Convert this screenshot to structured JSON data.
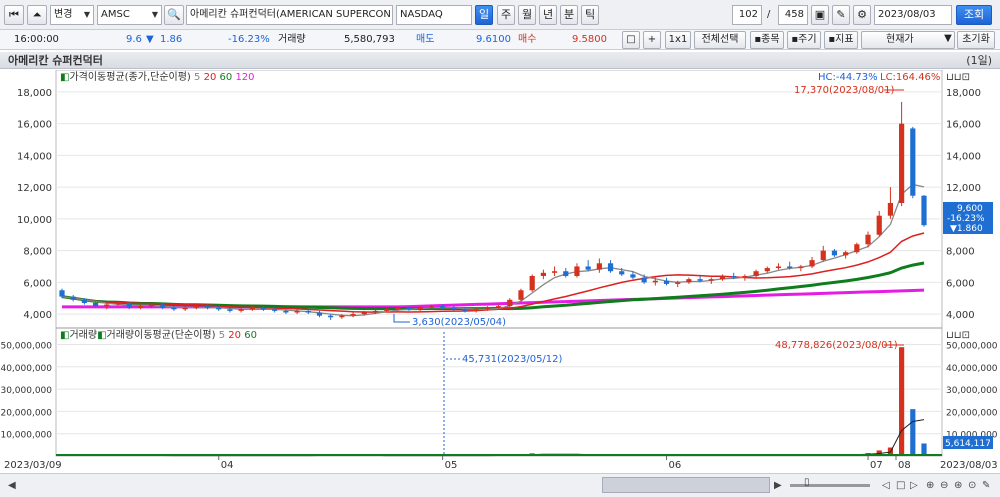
{
  "toolbar": {
    "nav_first": "⏮",
    "nav_top": "⏶",
    "change_label": "변경",
    "code": "AMSC",
    "name": "아메리칸 슈퍼컨덕터(AMERICAN SUPERCON",
    "exchange": "NASDAQ",
    "periods": [
      "일",
      "주",
      "월",
      "년",
      "분",
      "틱"
    ],
    "active_period": "일",
    "count": "102",
    "total": "458",
    "date": "2023/08/03",
    "search_label": "조회"
  },
  "quote": {
    "time": "16:00:00",
    "price": "9.6",
    "change_arrow": "▼",
    "change": "1.86",
    "change_pct": "-16.23%",
    "volume_label": "거래량",
    "volume": "5,580,793",
    "ask_label": "매도",
    "ask": "9.6100",
    "bid_label": "매수",
    "bid": "9.5800",
    "buttons": [
      "+",
      "1x1",
      "전체선택",
      "▪종목",
      "▪주기",
      "▪지표"
    ],
    "price_type": "현재가",
    "reset_label": "초기화"
  },
  "title": {
    "name": "아메리칸 슈퍼컨덕터",
    "period": "(1일)"
  },
  "colors": {
    "up": "#d4321e",
    "down": "#1f6fd2",
    "ma5": "#888888",
    "ma20": "#dd1f1f",
    "ma60": "#0f7d1e",
    "ma120": "#e61ce6",
    "accent": "#1e63d6"
  },
  "chart_data": [
    {
      "type": "candlestick",
      "legend": {
        "label": "가격이동평균(종가,단순이평)",
        "periods": [
          "5",
          "20",
          "60",
          "120"
        ]
      },
      "hc": "HC:-44.73%",
      "lc": "LC:164.46%",
      "high_annotation": "17,370(2023/08/01)",
      "low_annotation": "3,630(2023/05/04)",
      "last_label": [
        "9,600",
        "-16.23%",
        "▼1.860"
      ],
      "yticks": [
        "4,000",
        "6,000",
        "8,000",
        "10,000",
        "12,000",
        "14,000",
        "16,000",
        "18,000"
      ],
      "ylim": [
        3500,
        18500
      ],
      "ohlc": [
        [
          5.5,
          5.6,
          5.0,
          5.1
        ],
        [
          5.1,
          5.2,
          4.8,
          4.9
        ],
        [
          4.9,
          5.0,
          4.6,
          4.7
        ],
        [
          4.7,
          4.8,
          4.4,
          4.5
        ],
        [
          4.5,
          4.7,
          4.3,
          4.6
        ],
        [
          4.6,
          4.8,
          4.5,
          4.7
        ],
        [
          4.7,
          4.8,
          4.3,
          4.4
        ],
        [
          4.4,
          4.6,
          4.3,
          4.5
        ],
        [
          4.5,
          4.7,
          4.4,
          4.6
        ],
        [
          4.6,
          4.7,
          4.3,
          4.4
        ],
        [
          4.4,
          4.5,
          4.2,
          4.3
        ],
        [
          4.3,
          4.5,
          4.2,
          4.4
        ],
        [
          4.4,
          4.6,
          4.3,
          4.5
        ],
        [
          4.5,
          4.6,
          4.3,
          4.4
        ],
        [
          4.4,
          4.5,
          4.2,
          4.3
        ],
        [
          4.3,
          4.4,
          4.1,
          4.2
        ],
        [
          4.2,
          4.4,
          4.1,
          4.3
        ],
        [
          4.3,
          4.5,
          4.2,
          4.4
        ],
        [
          4.4,
          4.5,
          4.2,
          4.3
        ],
        [
          4.3,
          4.4,
          4.1,
          4.2
        ],
        [
          4.2,
          4.3,
          4.0,
          4.1
        ],
        [
          4.1,
          4.3,
          4.0,
          4.2
        ],
        [
          4.2,
          4.3,
          4.0,
          4.1
        ],
        [
          4.1,
          4.2,
          3.8,
          3.9
        ],
        [
          3.9,
          4.0,
          3.63,
          3.8
        ],
        [
          3.8,
          4.0,
          3.7,
          3.9
        ],
        [
          3.9,
          4.1,
          3.8,
          4.0
        ],
        [
          4.0,
          4.2,
          3.9,
          4.1
        ],
        [
          4.1,
          4.3,
          4.0,
          4.2
        ],
        [
          4.2,
          4.4,
          4.1,
          4.3
        ],
        [
          4.3,
          4.5,
          4.2,
          4.4
        ],
        [
          4.4,
          4.5,
          4.2,
          4.3
        ],
        [
          4.3,
          4.5,
          4.2,
          4.4
        ],
        [
          4.4,
          4.6,
          4.3,
          4.5
        ],
        [
          4.5,
          4.6,
          4.3,
          4.4
        ],
        [
          4.4,
          4.5,
          4.2,
          4.3
        ],
        [
          4.3,
          4.4,
          4.1,
          4.2
        ],
        [
          4.2,
          4.4,
          4.1,
          4.3
        ],
        [
          4.3,
          4.5,
          4.2,
          4.4
        ],
        [
          4.4,
          4.6,
          4.3,
          4.5
        ],
        [
          4.5,
          5.0,
          4.4,
          4.9
        ],
        [
          4.9,
          5.6,
          4.8,
          5.5
        ],
        [
          5.5,
          6.5,
          5.4,
          6.4
        ],
        [
          6.4,
          6.8,
          6.2,
          6.6
        ],
        [
          6.6,
          7.0,
          6.4,
          6.7
        ],
        [
          6.7,
          6.9,
          6.3,
          6.4
        ],
        [
          6.4,
          7.2,
          6.3,
          7.0
        ],
        [
          7.0,
          7.4,
          6.7,
          6.8
        ],
        [
          6.8,
          7.5,
          6.6,
          7.2
        ],
        [
          7.2,
          7.4,
          6.6,
          6.7
        ],
        [
          6.7,
          6.9,
          6.4,
          6.5
        ],
        [
          6.5,
          6.7,
          6.2,
          6.3
        ],
        [
          6.3,
          6.5,
          5.9,
          6.0
        ],
        [
          6.0,
          6.3,
          5.8,
          6.1
        ],
        [
          6.1,
          6.3,
          5.8,
          5.9
        ],
        [
          5.9,
          6.1,
          5.7,
          6.0
        ],
        [
          6.0,
          6.3,
          5.9,
          6.2
        ],
        [
          6.2,
          6.4,
          6.0,
          6.1
        ],
        [
          6.1,
          6.3,
          5.9,
          6.2
        ],
        [
          6.2,
          6.5,
          6.1,
          6.4
        ],
        [
          6.4,
          6.6,
          6.2,
          6.3
        ],
        [
          6.3,
          6.5,
          6.1,
          6.4
        ],
        [
          6.4,
          6.8,
          6.3,
          6.7
        ],
        [
          6.7,
          7.0,
          6.6,
          6.9
        ],
        [
          6.9,
          7.2,
          6.8,
          7.0
        ],
        [
          7.0,
          7.3,
          6.8,
          6.9
        ],
        [
          6.9,
          7.1,
          6.7,
          7.0
        ],
        [
          7.0,
          7.6,
          6.9,
          7.4
        ],
        [
          7.4,
          8.3,
          7.3,
          8.0
        ],
        [
          8.0,
          8.1,
          7.6,
          7.7
        ],
        [
          7.7,
          8.0,
          7.5,
          7.9
        ],
        [
          7.9,
          8.5,
          7.8,
          8.4
        ],
        [
          8.4,
          9.2,
          8.2,
          9.0
        ],
        [
          9.0,
          10.5,
          8.9,
          10.2
        ],
        [
          10.2,
          12.0,
          10.0,
          11.0
        ],
        [
          11.0,
          17.37,
          10.8,
          16.0
        ],
        [
          15.7,
          15.8,
          11.3,
          11.46
        ],
        [
          11.46,
          11.5,
          9.5,
          9.6
        ]
      ]
    },
    {
      "type": "bar",
      "legend": {
        "volume_label": "거래량",
        "ma_label": "거래량이동평균(단순이평)",
        "periods": [
          "5",
          "20",
          "60"
        ]
      },
      "high_annotation": "48,778,826(2023/08/01)",
      "low_annotation": "45,731(2023/05/12)",
      "last_label": "5,614,117",
      "yticks": [
        "10,000,000",
        "20,000,000",
        "30,000,000",
        "40,000,000",
        "50,000,000"
      ],
      "ylim": [
        0,
        52000000
      ],
      "values": [
        0.4,
        0.3,
        0.3,
        0.2,
        0.2,
        0.3,
        0.2,
        0.2,
        0.2,
        0.2,
        0.2,
        0.2,
        0.2,
        0.2,
        0.2,
        0.2,
        0.2,
        0.2,
        0.2,
        0.2,
        0.2,
        0.2,
        0.2,
        0.3,
        0.4,
        0.2,
        0.2,
        0.2,
        0.2,
        0.2,
        0.2,
        0.2,
        0.2,
        0.2,
        0.2,
        0.2,
        0.2,
        0.2,
        0.2,
        0.3,
        0.5,
        0.9,
        1.2,
        0.8,
        0.6,
        0.5,
        0.7,
        0.6,
        0.6,
        0.5,
        0.4,
        0.4,
        0.4,
        0.3,
        0.3,
        0.3,
        0.3,
        0.3,
        0.3,
        0.3,
        0.3,
        0.3,
        0.4,
        0.4,
        0.4,
        0.3,
        0.3,
        0.5,
        0.9,
        0.5,
        0.5,
        0.7,
        1.3,
        2.5,
        3.8,
        48.78,
        21.0,
        5.61
      ]
    }
  ],
  "x_axis": {
    "start": "2023/03/09",
    "end": "2023/08/03",
    "months": [
      "04",
      "05",
      "06",
      "07",
      "08"
    ]
  }
}
